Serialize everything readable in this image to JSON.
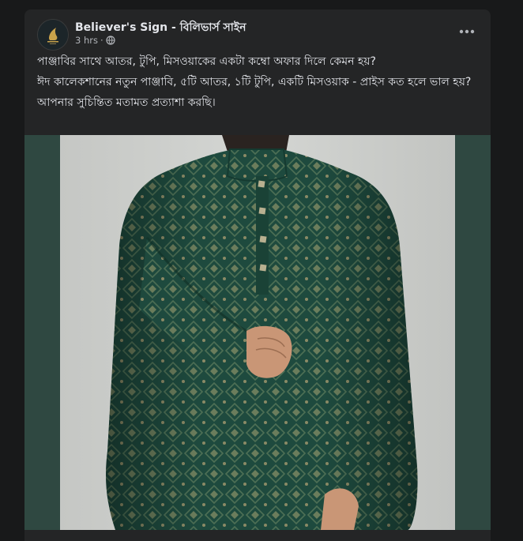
{
  "post": {
    "page_name": "Believer's Sign - বিলিভার্স সাইন",
    "time": "3 hrs",
    "dot": "·",
    "privacy_icon": "globe-icon",
    "more_icon": "more-horizontal-icon",
    "paragraphs": [
      "পাঞ্জাবির সাথে আতর, টুপি, মিসওয়াকের একটা কম্বো অফার দিলে কেমন হয়?",
      "ঈদ কালেকশানের নতুন পাঞ্জাবি, ৫টি আতর, ১টি টুপি, একটি মিসওয়াক - প্রাইস কত হলে ভাল হয়?",
      "আপনার সুচিন্তিত মতামত প্রত্যাশা করছি।"
    ],
    "image": {
      "subject": "dark-green-patterned-panjabi",
      "background_color": "#2f4841",
      "fabric_color": "#1f4a3e"
    }
  },
  "colors": {
    "page_background": "#18191a",
    "card_background": "#242526",
    "primary_text": "#e4e6eb",
    "secondary_text": "#b0b3b8"
  }
}
